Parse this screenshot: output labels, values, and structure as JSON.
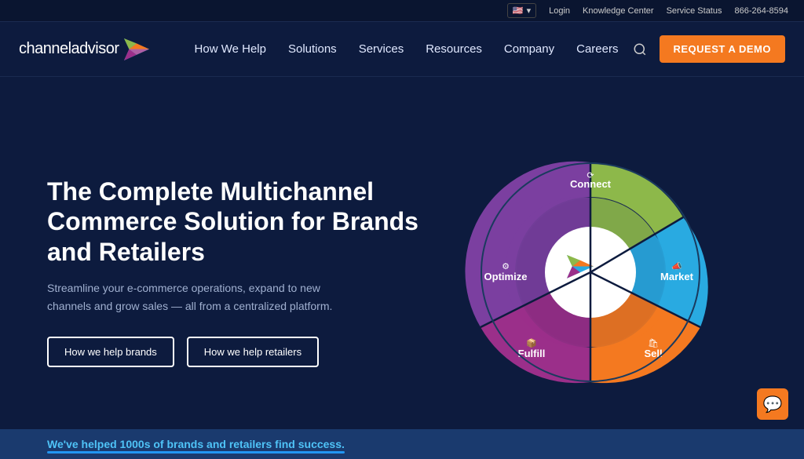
{
  "utility_bar": {
    "flag_label": "🇺🇸",
    "flag_dropdown_label": "▾",
    "login_label": "Login",
    "knowledge_center_label": "Knowledge Center",
    "service_status_label": "Service Status",
    "phone_label": "866-264-8594"
  },
  "navbar": {
    "logo_text": "channeladvisor",
    "nav_links": [
      {
        "id": "how-we-help",
        "label": "How We Help"
      },
      {
        "id": "solutions",
        "label": "Solutions"
      },
      {
        "id": "services",
        "label": "Services"
      },
      {
        "id": "resources",
        "label": "Resources"
      },
      {
        "id": "company",
        "label": "Company"
      },
      {
        "id": "careers",
        "label": "Careers"
      }
    ],
    "demo_button_label": "REQUEST A DEMO"
  },
  "hero": {
    "title": "The Complete Multichannel Commerce Solution for Brands and Retailers",
    "subtitle": "Streamline your e-commerce operations, expand to new channels and grow sales — all from a centralized platform.",
    "btn_brands_label": "How we help brands",
    "btn_retailers_label": "How we help retailers",
    "wheel_segments": [
      {
        "id": "connect",
        "label": "Connect",
        "color": "#8db84a"
      },
      {
        "id": "market",
        "label": "Market",
        "color": "#29aae1"
      },
      {
        "id": "sell",
        "label": "Sell",
        "color": "#f47920"
      },
      {
        "id": "fulfill",
        "label": "Fulfill",
        "color": "#9b2f8a"
      },
      {
        "id": "optimize",
        "label": "Optimize",
        "color": "#7b3fa0"
      }
    ]
  },
  "bottom_bar": {
    "text": "We've helped 1000s of brands and retailers find success."
  },
  "chat_icon_label": "💬"
}
